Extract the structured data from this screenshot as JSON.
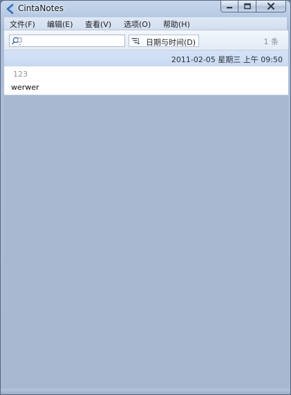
{
  "window": {
    "title": "CintaNotes",
    "controls": [
      "minimize-icon",
      "maximize-icon",
      "close-icon"
    ]
  },
  "menu": {
    "items": [
      "文件(F)",
      "编辑(E)",
      "查看(V)",
      "选项(O)",
      "帮助(H)"
    ]
  },
  "toolbar": {
    "search_value": "",
    "search_icon": "search-icon",
    "sort_icon": "sort-icon",
    "sort_label": "日期与时间(D)",
    "count": "1 条"
  },
  "notes": [
    {
      "date": "2011-02-05 星期三 上午 09:50",
      "title": "123",
      "text": "werwer"
    }
  ],
  "colors": {
    "window_frame": "#b7cae3",
    "note_header": "#d0dff4",
    "list_background": "#a8b8d1",
    "note_body": "#ffffff"
  }
}
